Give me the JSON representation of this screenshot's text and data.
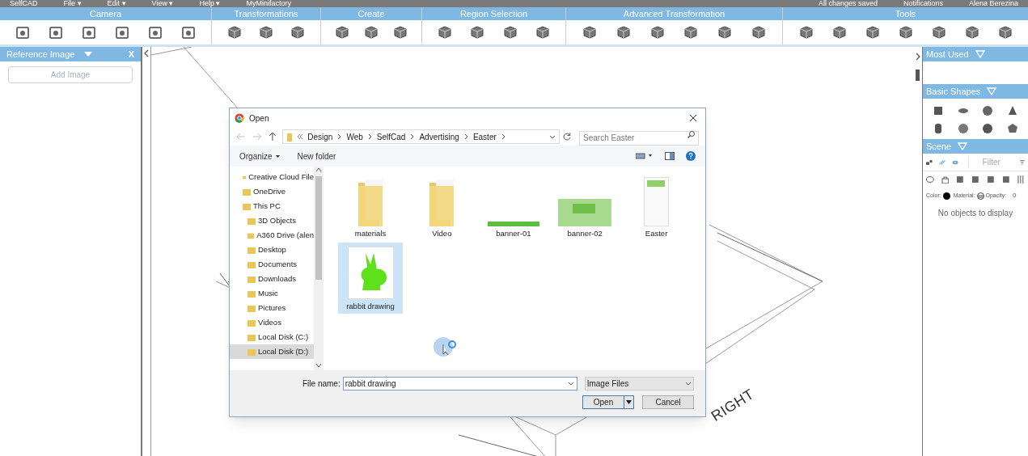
{
  "menu_bar": {
    "logo": "SelfCAD",
    "menus": [
      "File ▾",
      "Edit ▾",
      "View ▾",
      "Help ▾"
    ],
    "link": "MyMinifactory",
    "save_status": "All changes saved",
    "notifications": "Notifications",
    "user": "Alena Berezina"
  },
  "ribbon": {
    "groups": [
      {
        "label": "Camera"
      },
      {
        "label": "Transformations"
      },
      {
        "label": "Create"
      },
      {
        "label": "Region Selection"
      },
      {
        "label": "Advanced Transformation"
      },
      {
        "label": "Tools"
      }
    ]
  },
  "left_panel": {
    "title": "Reference Image",
    "close": "X",
    "button": "Add Image"
  },
  "right_panel": {
    "sections": [
      {
        "title": "Most Used",
        "kind": "empty"
      },
      {
        "title": "Basic Shapes",
        "kind": "shapes"
      },
      {
        "title": "Scene",
        "kind": "scene"
      }
    ],
    "filter_placeholder": "Filter",
    "color_label": "Color:",
    "material_label": "Material:",
    "opacity_label": "Opacity:",
    "opacity_value": "0",
    "empty_text": "No objects to display"
  },
  "viewport": {
    "axis_label": "RIGHT"
  },
  "dialog": {
    "title": "Open",
    "breadcrumb": [
      "Design",
      "Web",
      "SelfCad",
      "Advertising",
      "Easter"
    ],
    "search_placeholder": "Search Easter",
    "organize": "Organize",
    "new_folder": "New folder",
    "nav": [
      {
        "label": "Creative Cloud File",
        "selected": false
      },
      {
        "label": "OneDrive",
        "selected": false
      },
      {
        "label": "This PC",
        "selected": false,
        "children": [
          {
            "label": "3D Objects",
            "selected": false
          },
          {
            "label": "A360 Drive (alen",
            "selected": false
          },
          {
            "label": "Desktop",
            "selected": false
          },
          {
            "label": "Documents",
            "selected": false
          },
          {
            "label": "Downloads",
            "selected": false
          },
          {
            "label": "Music",
            "selected": false
          },
          {
            "label": "Pictures",
            "selected": false
          },
          {
            "label": "Videos",
            "selected": false
          },
          {
            "label": "Local Disk (C:)",
            "selected": false
          },
          {
            "label": "Local Disk (D:)",
            "selected": true
          }
        ]
      }
    ],
    "files": [
      {
        "name": "materials",
        "kind": "folder",
        "selected": false
      },
      {
        "name": "Video",
        "kind": "folder",
        "selected": false
      },
      {
        "name": "banner-01",
        "kind": "strip",
        "selected": false
      },
      {
        "name": "banner-02",
        "kind": "banner",
        "selected": false
      },
      {
        "name": "Easter",
        "kind": "page",
        "selected": false
      },
      {
        "name": "rabbit drawing",
        "kind": "rabbit",
        "selected": true
      }
    ],
    "file_name_label": "File name:",
    "file_name": "rabbit drawing",
    "file_type": "Image Files",
    "open": "Open",
    "cancel": "Cancel"
  }
}
